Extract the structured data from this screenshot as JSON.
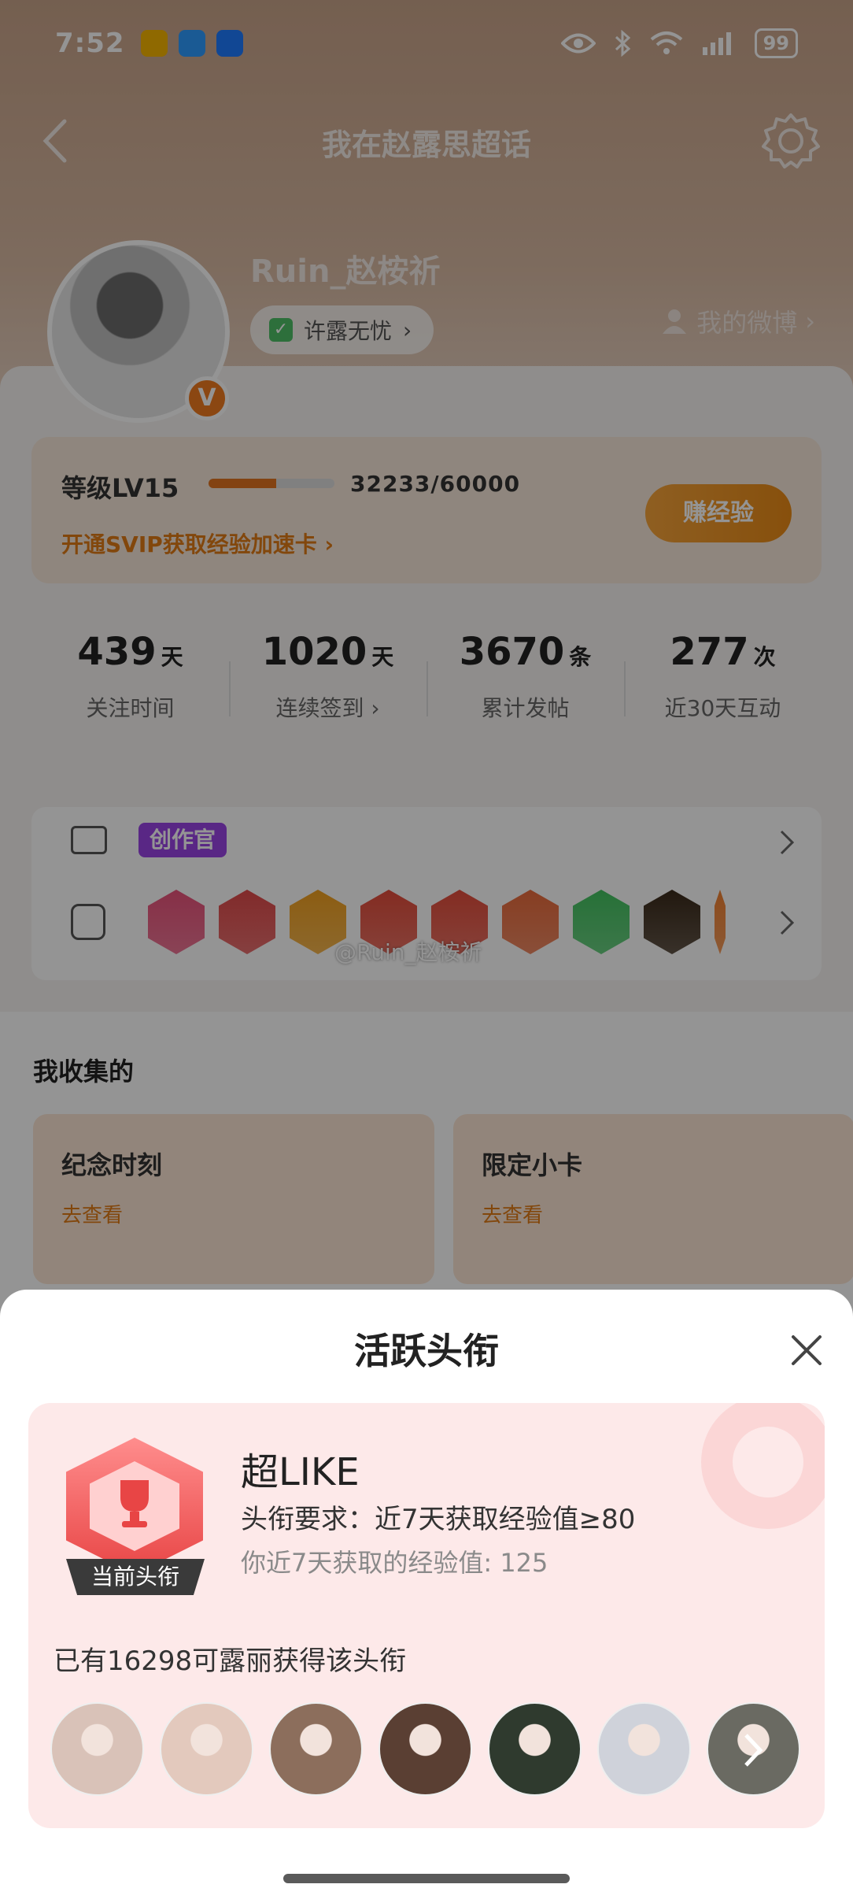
{
  "status_bar": {
    "time": "7:52",
    "battery": "99"
  },
  "nav": {
    "title": "我在赵露思超话"
  },
  "profile": {
    "username": "Ruin_赵桉祈",
    "tag": "许露无忧",
    "my_weibo": "我的微博"
  },
  "level": {
    "label": "等级LV15",
    "progress_text": "32233/60000",
    "progress_fraction": 0.537,
    "svip_link": "开通SVIP获取经验加速卡",
    "earn_button": "赚经验"
  },
  "stats": [
    {
      "value": "439",
      "unit": "天",
      "label": "关注时间"
    },
    {
      "value": "1020",
      "unit": "天",
      "label": "连续签到"
    },
    {
      "value": "3670",
      "unit": "条",
      "label": "累计发帖"
    },
    {
      "value": "277",
      "unit": "次",
      "label": "近30天互动"
    }
  ],
  "badges": {
    "creator": "创作官",
    "medal_colors": [
      "#e8527a",
      "#e04a4a",
      "#f0a020",
      "#e24c3b",
      "#e24c3b",
      "#e86a3b",
      "#43c260",
      "#3a2a1a",
      "#f08030"
    ]
  },
  "watermark": "@Ruin_赵桉祈",
  "collection": {
    "title": "我收集的",
    "cards": [
      {
        "title": "纪念时刻",
        "sub": "去查看"
      },
      {
        "title": "限定小卡",
        "sub": "去查看"
      }
    ]
  },
  "sheet": {
    "title": "活跃头衔",
    "badge_name": "超LIKE",
    "current_label": "当前头衔",
    "requirement": "头衔要求：近7天获取经验值≥80",
    "my_value": "你近7天获取的经验值: 125",
    "holders": "已有16298可露丽获得该头衔",
    "avatar_colors": [
      "#d9c2b8",
      "#e3c9bd",
      "#8c6e5c",
      "#5a3f33",
      "#2f3a2e",
      "#cfd2da",
      "#6a6a62"
    ]
  }
}
